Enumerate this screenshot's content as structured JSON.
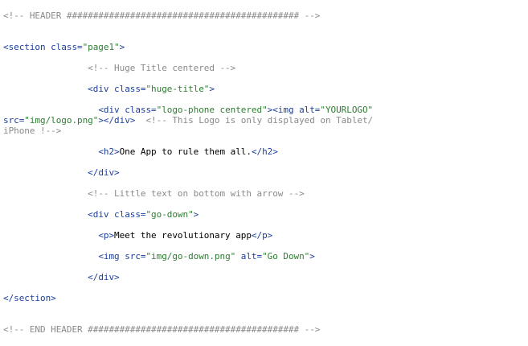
{
  "editor": {
    "lines": [
      {
        "id": "l1",
        "indent": "",
        "tokens": [
          {
            "t": "comment",
            "v": "<!-- HEADER ############################################ -->"
          }
        ]
      },
      {
        "id": "l2",
        "indent": "",
        "tokens": [
          {
            "t": "tag",
            "v": "<section "
          },
          {
            "t": "attr",
            "v": "class="
          },
          {
            "t": "value",
            "v": "\"page1\""
          },
          {
            "t": "tag",
            "v": ">"
          }
        ]
      },
      {
        "id": "l3",
        "indent": "                ",
        "tokens": [
          {
            "t": "comment",
            "v": "<!-- Huge Title centered -->"
          }
        ]
      },
      {
        "id": "l4",
        "indent": "                ",
        "tokens": [
          {
            "t": "tag",
            "v": "<div "
          },
          {
            "t": "attr",
            "v": "class="
          },
          {
            "t": "value",
            "v": "\"huge-title\""
          },
          {
            "t": "tag",
            "v": ">"
          }
        ]
      },
      {
        "id": "l5",
        "indent": "                  ",
        "tokens": [
          {
            "t": "tag",
            "v": "<div "
          },
          {
            "t": "attr",
            "v": "class="
          },
          {
            "t": "value",
            "v": "\"logo-phone centered\""
          },
          {
            "t": "tag",
            "v": "><img "
          },
          {
            "t": "attr",
            "v": "alt="
          },
          {
            "t": "value",
            "v": "\"YOURLOGO\""
          }
        ]
      },
      {
        "id": "l6",
        "indent": "",
        "tokens": [
          {
            "t": "attr",
            "v": "src="
          },
          {
            "t": "value",
            "v": "\"img/logo.png\""
          },
          {
            "t": "tag",
            "v": "></div>"
          },
          {
            "t": "comment",
            "v": "  <!-- This Logo is only displayed on Tablet/"
          }
        ]
      },
      {
        "id": "l7",
        "indent": "",
        "tokens": [
          {
            "t": "comment",
            "v": "iPhone !-->"
          }
        ]
      },
      {
        "id": "l8",
        "indent": "                  ",
        "tokens": [
          {
            "t": "tag",
            "v": "<h2>"
          },
          {
            "t": "text",
            "v": "One App to rule them all."
          },
          {
            "t": "tag",
            "v": "</h2>"
          }
        ]
      },
      {
        "id": "l9",
        "indent": "                ",
        "tokens": [
          {
            "t": "tag",
            "v": "</div>"
          }
        ]
      },
      {
        "id": "l10",
        "indent": "                ",
        "tokens": [
          {
            "t": "comment",
            "v": "<!-- Little text on bottom with arrow -->"
          }
        ]
      },
      {
        "id": "l11",
        "indent": "                ",
        "tokens": [
          {
            "t": "tag",
            "v": "<div "
          },
          {
            "t": "attr",
            "v": "class="
          },
          {
            "t": "value",
            "v": "\"go-down\""
          },
          {
            "t": "tag",
            "v": ">"
          }
        ]
      },
      {
        "id": "l12",
        "indent": "                  ",
        "tokens": [
          {
            "t": "tag",
            "v": "<p>"
          },
          {
            "t": "text",
            "v": "Meet the revolutionary app"
          },
          {
            "t": "tag",
            "v": "</p>"
          }
        ]
      },
      {
        "id": "l13",
        "indent": "                  ",
        "tokens": [
          {
            "t": "tag",
            "v": "<img "
          },
          {
            "t": "attr",
            "v": "src="
          },
          {
            "t": "value",
            "v": "\"img/go-down.png\""
          },
          {
            "t": "attr",
            "v": " alt="
          },
          {
            "t": "value",
            "v": "\"Go Down\""
          },
          {
            "t": "tag",
            "v": ">"
          }
        ]
      },
      {
        "id": "l14",
        "indent": "                ",
        "tokens": [
          {
            "t": "tag",
            "v": "</div>"
          }
        ]
      },
      {
        "id": "l15",
        "indent": "",
        "tokens": [
          {
            "t": "tag",
            "v": "</section>"
          }
        ]
      },
      {
        "id": "l16",
        "indent": "",
        "tokens": [
          {
            "t": "comment",
            "v": "<!-- END HEADER ######################################## -->"
          }
        ]
      }
    ]
  },
  "colors": {
    "comment": "#8a8a8a",
    "tag": "#1b3e9c",
    "attr": "#1b3e9c",
    "value": "#2e7d32",
    "text": "#000000",
    "background": "#ffffff"
  }
}
